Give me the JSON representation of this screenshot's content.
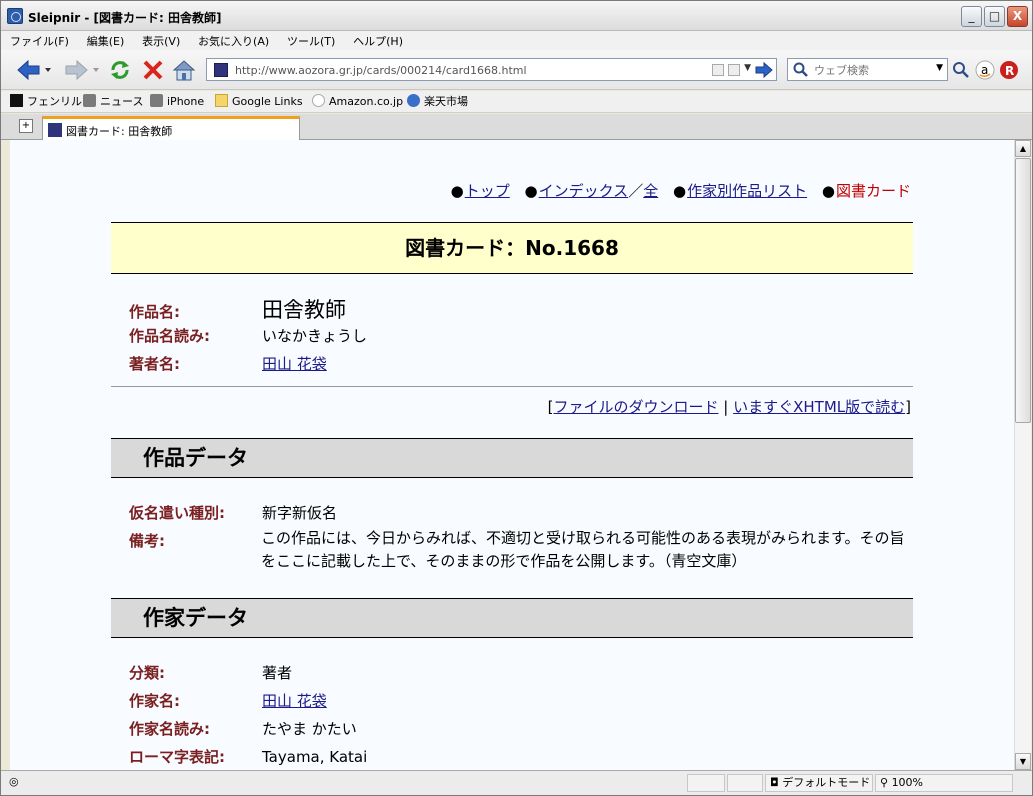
{
  "window": {
    "title": "Sleipnir - [図書カード: 田舎教師]",
    "buttons": {
      "minimize": "_",
      "maximize": "□",
      "close": "X"
    }
  },
  "menu": [
    "ファイル(F)",
    "編集(E)",
    "表示(V)",
    "お気に入り(A)",
    "ツール(T)",
    "ヘルプ(H)"
  ],
  "address": {
    "url": "http://www.aozora.gr.jp/cards/000214/card1668.html"
  },
  "search": {
    "placeholder": "ウェブ検索"
  },
  "bookmarks": [
    "フェンリル",
    "ニュース",
    "iPhone",
    "Google Links",
    "Amazon.co.jp",
    "楽天市場"
  ],
  "tab": {
    "label": "図書カード: 田舎教師"
  },
  "page": {
    "nav": {
      "top": "トップ",
      "index": "インデックス",
      "slash": "／",
      "all": "全",
      "authors": "作家別作品リスト",
      "current": "図書カード"
    },
    "card_title": "図書カード：No.1668",
    "work": {
      "title_label": "作品名:",
      "title": "田舎教師",
      "reading_label": "作品名読み:",
      "reading": "いなかきょうし",
      "author_label": "著者名:",
      "author": "田山 花袋"
    },
    "download": {
      "open": "[",
      "file_link": "ファイルのダウンロード",
      "sep": " | ",
      "xhtml_link": "いますぐXHTML版で読む",
      "close": "]"
    },
    "work_data": {
      "heading": "作品データ",
      "kana_label": "仮名遣い種別:",
      "kana": "新字新仮名",
      "note_label": "備考:",
      "note": "この作品には、今日からみれば、不適切と受け取られる可能性のある表現がみられます。その旨をここに記載した上で、そのままの形で作品を公開します。（青空文庫）"
    },
    "author_data": {
      "heading": "作家データ",
      "class_label": "分類:",
      "class": "著者",
      "name_label": "作家名:",
      "name": "田山 花袋",
      "reading_label": "作家名読み:",
      "reading": "たやま かたい",
      "roman_label": "ローマ字表記:",
      "roman": "Tayama, Katai"
    }
  },
  "status": {
    "mode": "デフォルトモード",
    "zoom": "100%"
  }
}
